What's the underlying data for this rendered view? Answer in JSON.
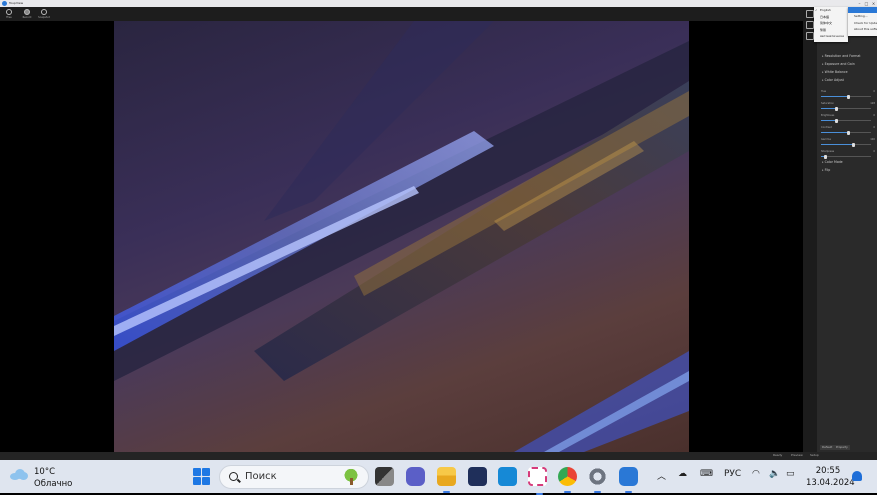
{
  "window": {
    "title": "ToupView"
  },
  "toolbar": {
    "buttons": [
      {
        "label": "Files",
        "icon": "gear-icon"
      },
      {
        "label": "Record",
        "icon": "record-icon"
      },
      {
        "label": "Snapshot",
        "icon": "snapshot-icon"
      }
    ]
  },
  "status_bar": {
    "items": [
      "Ready",
      "Preview",
      "Setup"
    ]
  },
  "panel": {
    "sections": [
      "Resolution and Format",
      "Exposure and Gain",
      "White Balance",
      "Color Adjust"
    ],
    "sliders": [
      {
        "label": "Hue",
        "value": "0",
        "level": 0.55
      },
      {
        "label": "Saturation",
        "value": "128",
        "level": 0.3
      },
      {
        "label": "Brightness",
        "value": "0",
        "level": 0.3
      },
      {
        "label": "Contrast",
        "value": "0",
        "level": 0.55
      },
      {
        "label": "Gamma",
        "value": "100",
        "level": 0.65
      },
      {
        "label": "Sharpness",
        "value": "0",
        "level": 0.08
      }
    ],
    "sections_after": [
      "Color Mode",
      "Flip"
    ],
    "buttons": [
      "Default",
      "Property"
    ]
  },
  "language_menu": {
    "items": [
      "English",
      "日本語",
      "简体中文",
      "繁體",
      "Автоматически"
    ],
    "selected": 0
  },
  "settings_menu": {
    "header": "",
    "items": [
      "Setting...",
      "Check for Updates...",
      "About this software..."
    ]
  },
  "taskbar": {
    "weather": {
      "temp": "10°C",
      "condition": "Облачно"
    },
    "search_placeholder": "Поиск",
    "language": "РУС",
    "time": "20:55",
    "date": "13.04.2024"
  },
  "colors": {
    "accent": "#1e78e4",
    "panel_bg": "#2a2a2a",
    "taskbar_bg": "#dfe5ef"
  }
}
